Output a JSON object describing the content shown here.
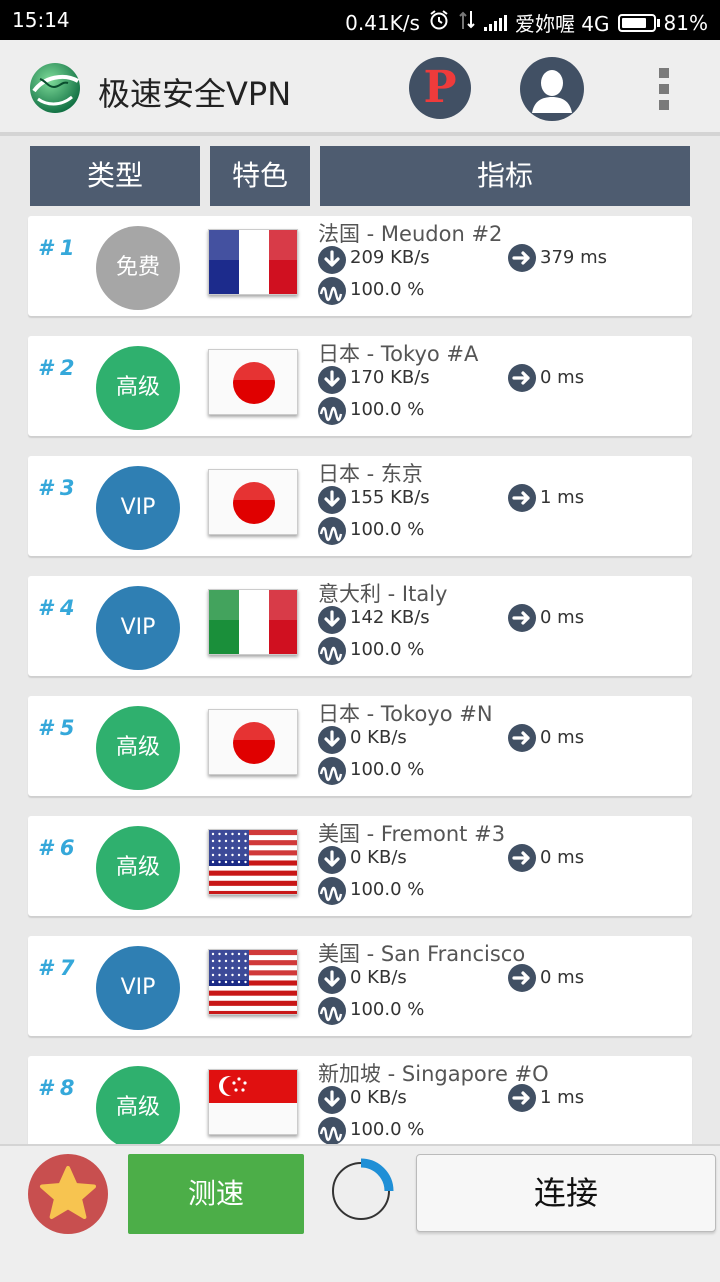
{
  "status_bar": {
    "time": "15:14",
    "net_speed": "0.41K/s",
    "carrier": "爱妳喔 4G",
    "battery": "81%"
  },
  "app_bar": {
    "title": "极速安全VPN",
    "p_button_label": "P",
    "icons": [
      "globe-logo-icon",
      "user-icon",
      "overflow-menu-icon"
    ]
  },
  "columns": [
    "类型",
    "特色",
    "指标"
  ],
  "colors": {
    "free": "#a6a6a6",
    "premium": "#2fb06e",
    "vip": "#2f7fb3",
    "rank": "#35a8da",
    "header": "#4e5c70"
  },
  "servers": [
    {
      "rank": "# 1",
      "tier": "免费",
      "tier_type": "free",
      "flag": "france",
      "name": "法国 - Meudon #2",
      "download": "209 KB/s",
      "ping": "379 ms",
      "uptime": "100.0 %"
    },
    {
      "rank": "# 2",
      "tier": "高级",
      "tier_type": "premium",
      "flag": "japan",
      "name": "日本 - Tokyo #A",
      "download": "170 KB/s",
      "ping": "0 ms",
      "uptime": "100.0 %"
    },
    {
      "rank": "# 3",
      "tier": "VIP",
      "tier_type": "vip",
      "flag": "japan",
      "name": "日本 - 东京",
      "download": "155 KB/s",
      "ping": "1 ms",
      "uptime": "100.0 %"
    },
    {
      "rank": "# 4",
      "tier": "VIP",
      "tier_type": "vip",
      "flag": "italy",
      "name": "意大利 - Italy",
      "download": "142 KB/s",
      "ping": "0 ms",
      "uptime": "100.0 %"
    },
    {
      "rank": "# 5",
      "tier": "高级",
      "tier_type": "premium",
      "flag": "japan",
      "name": "日本 - Tokoyo #N",
      "download": "0 KB/s",
      "ping": "0 ms",
      "uptime": "100.0 %"
    },
    {
      "rank": "# 6",
      "tier": "高级",
      "tier_type": "premium",
      "flag": "usa",
      "name": "美国 - Fremont #3",
      "download": "0 KB/s",
      "ping": "0 ms",
      "uptime": "100.0 %"
    },
    {
      "rank": "# 7",
      "tier": "VIP",
      "tier_type": "vip",
      "flag": "usa",
      "name": "美国 - San Francisco",
      "download": "0 KB/s",
      "ping": "0 ms",
      "uptime": "100.0 %"
    },
    {
      "rank": "# 8",
      "tier": "高级",
      "tier_type": "premium",
      "flag": "singapore",
      "name": "新加坡 - Singapore #O",
      "download": "0 KB/s",
      "ping": "1 ms",
      "uptime": "100.0 %"
    }
  ],
  "bottom_bar": {
    "favorite_icon": "star-icon",
    "speed_test_label": "测速",
    "connect_label": "连接"
  }
}
